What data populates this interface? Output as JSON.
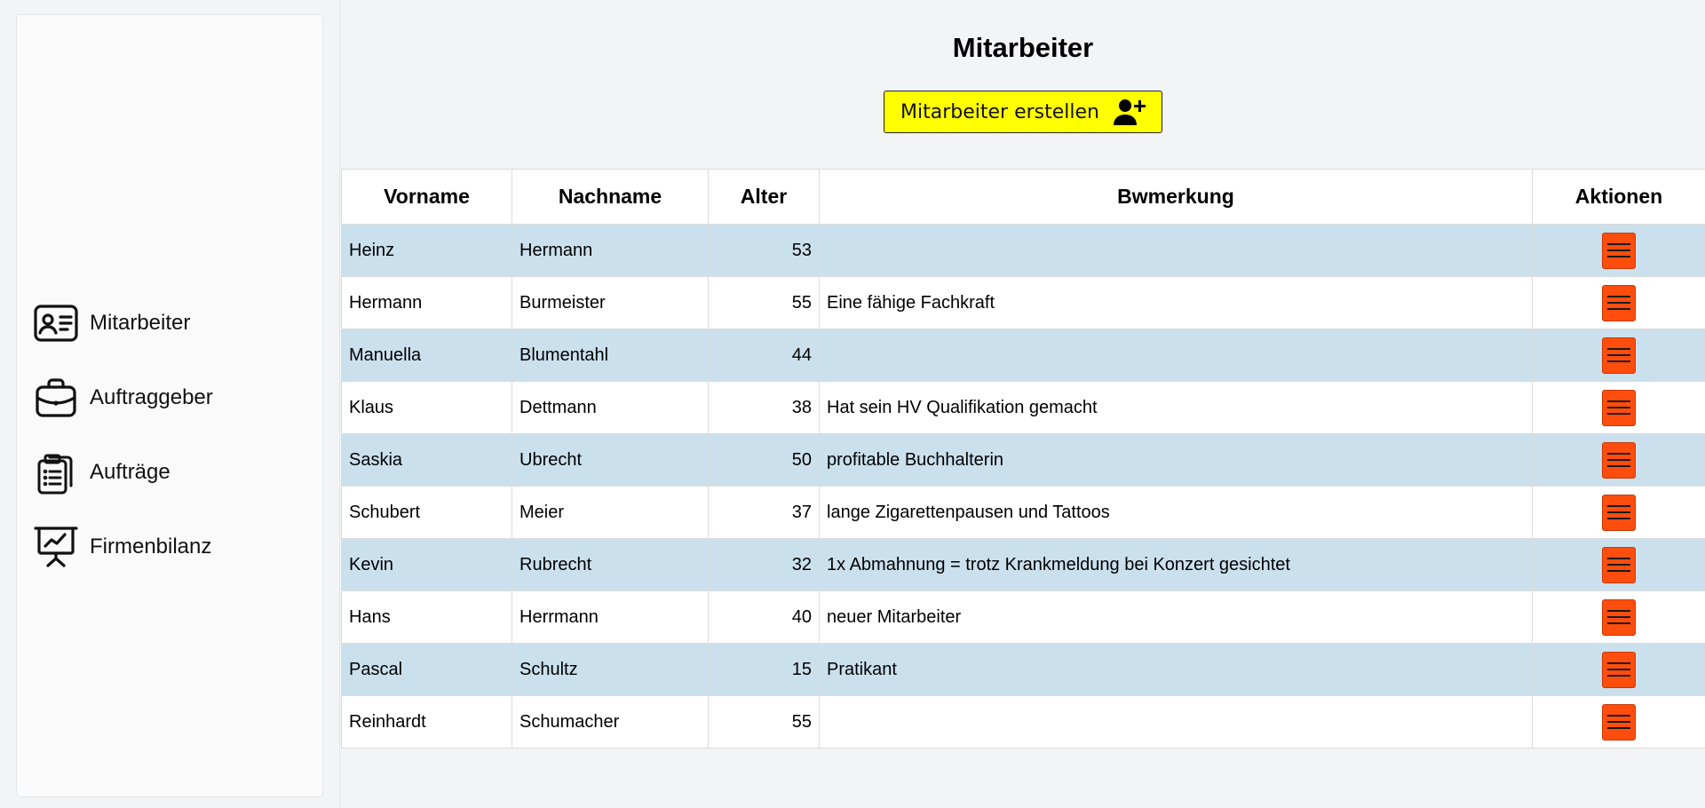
{
  "sidebar": {
    "items": [
      {
        "label": "Mitarbeiter",
        "icon": "id-card-icon"
      },
      {
        "label": "Auftraggeber",
        "icon": "briefcase-icon"
      },
      {
        "label": "Aufträge",
        "icon": "clipboard-list-icon"
      },
      {
        "label": "Firmenbilanz",
        "icon": "presentation-chart-icon"
      }
    ]
  },
  "main": {
    "title": "Mitarbeiter",
    "create_button": {
      "label": "Mitarbeiter erstellen",
      "icon": "user-plus-icon",
      "color": "#ffff00"
    },
    "table": {
      "headers": [
        "Vorname",
        "Nachname",
        "Alter",
        "Bwmerkung",
        "Aktionen"
      ],
      "rows": [
        {
          "vorname": "Heinz",
          "nachname": "Hermann",
          "alter": "53",
          "bemerkung": ""
        },
        {
          "vorname": "Hermann",
          "nachname": "Burmeister",
          "alter": "55",
          "bemerkung": "Eine fähige Fachkraft"
        },
        {
          "vorname": "Manuella",
          "nachname": "Blumentahl",
          "alter": "44",
          "bemerkung": ""
        },
        {
          "vorname": "Klaus",
          "nachname": "Dettmann",
          "alter": "38",
          "bemerkung": "Hat sein HV Qualifikation gemacht"
        },
        {
          "vorname": "Saskia",
          "nachname": "Ubrecht",
          "alter": "50",
          "bemerkung": "profitable Buchhalterin"
        },
        {
          "vorname": "Schubert",
          "nachname": "Meier",
          "alter": "37",
          "bemerkung": "lange Zigarettenpausen und Tattoos"
        },
        {
          "vorname": "Kevin",
          "nachname": "Rubrecht",
          "alter": "32",
          "bemerkung": "1x Abmahnung = trotz Krankmeldung bei Konzert gesichtet"
        },
        {
          "vorname": "Hans",
          "nachname": "Herrmann",
          "alter": "40",
          "bemerkung": "neuer Mitarbeiter"
        },
        {
          "vorname": "Pascal",
          "nachname": "Schultz",
          "alter": "15",
          "bemerkung": "Pratikant"
        },
        {
          "vorname": "Reinhardt",
          "nachname": "Schumacher",
          "alter": "55",
          "bemerkung": ""
        }
      ],
      "row_alt_color": "#cbe0ed",
      "action_icon": "hamburger-menu-icon",
      "action_color": "#ff4d0d"
    }
  }
}
